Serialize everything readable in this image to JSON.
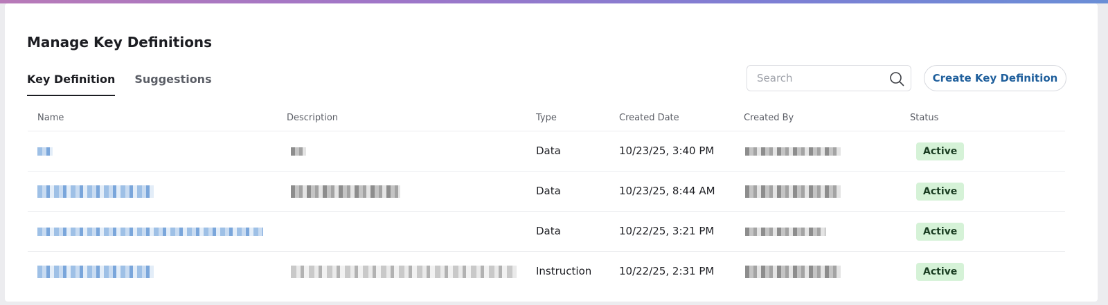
{
  "page": {
    "title": "Manage Key Definitions"
  },
  "tabs": [
    {
      "label": "Key Definition",
      "active": true
    },
    {
      "label": "Suggestions",
      "active": false
    }
  ],
  "search": {
    "placeholder": "Search",
    "value": ""
  },
  "toolbar": {
    "create_label": "Create Key Definition"
  },
  "table": {
    "columns": [
      "Name",
      "Description",
      "Type",
      "Created Date",
      "Created By",
      "Status"
    ],
    "rows": [
      {
        "type": "Data",
        "created_date": "10/23/25, 3:40 PM",
        "status": "Active"
      },
      {
        "type": "Data",
        "created_date": "10/23/25, 8:44 AM",
        "status": "Active"
      },
      {
        "type": "Data",
        "created_date": "10/22/25, 3:21 PM",
        "status": "Active"
      },
      {
        "type": "Instruction",
        "created_date": "10/22/25, 2:31 PM",
        "status": "Active"
      }
    ]
  },
  "colors": {
    "accent": "#1f5f9c",
    "status_active_bg": "#d5f2d7",
    "tab_active": "#1c1d22"
  },
  "icons": {
    "search": "search-icon"
  }
}
